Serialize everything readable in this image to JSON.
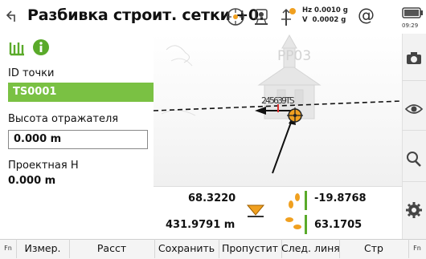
{
  "header": {
    "title": "Разбивка строит. сетки +0.",
    "hz": "Hz 0.0010 g",
    "v": "V  0.0002 g",
    "at": "@",
    "clock": "09:29"
  },
  "left_panel": {
    "point_id_label": "ID точки",
    "point_id_value": "TS0001",
    "reflector_height_label": "Высота отражателя",
    "reflector_height_value": "0.000 m",
    "design_height_label": "Проектная H",
    "design_height_value": "0.000 m"
  },
  "view": {
    "target_label": "PP03",
    "overlap_label": "245639TS"
  },
  "measurements": {
    "value_top_left": "68.3220",
    "value_bottom_left": "431.9791 m",
    "value_top_right": "-19.8768",
    "value_bottom_right": "63.1705"
  },
  "softkeys": {
    "fn_left": "Fn",
    "items": [
      "Измер.",
      "Расст",
      "Сохранить",
      "Пропустит",
      "След. линя",
      "Стр"
    ],
    "fn_right": "Fn"
  },
  "colors": {
    "green": "#7ac143",
    "orange": "#f0a020",
    "red": "#e03030"
  }
}
